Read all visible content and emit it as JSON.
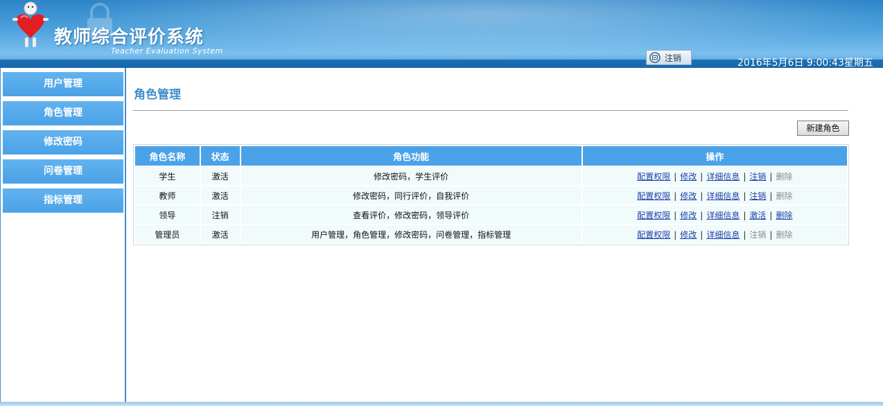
{
  "header": {
    "title_cn": "教师综合评价系统",
    "title_en": "Teacher Evaluation System",
    "logout_label": "注销",
    "datetime": "2016年5月6日 9:00:43星期五"
  },
  "sidebar": {
    "items": [
      {
        "label": "用户管理"
      },
      {
        "label": "角色管理"
      },
      {
        "label": "修改密码"
      },
      {
        "label": "问卷管理"
      },
      {
        "label": "指标管理"
      }
    ]
  },
  "main": {
    "page_title": "角色管理",
    "new_role_label": "新建角色",
    "table": {
      "columns": [
        "角色名称",
        "状态",
        "角色功能",
        "操作"
      ],
      "rows": [
        {
          "name": "学生",
          "status": "激活",
          "functions": "修改密码，学生评价",
          "ops": [
            {
              "label": "配置权限",
              "enabled": true
            },
            {
              "label": "修改",
              "enabled": true
            },
            {
              "label": "详细信息",
              "enabled": true
            },
            {
              "label": "注销",
              "enabled": true
            },
            {
              "label": "删除",
              "enabled": false
            }
          ]
        },
        {
          "name": "教师",
          "status": "激活",
          "functions": "修改密码，同行评价，自我评价",
          "ops": [
            {
              "label": "配置权限",
              "enabled": true
            },
            {
              "label": "修改",
              "enabled": true
            },
            {
              "label": "详细信息",
              "enabled": true
            },
            {
              "label": "注销",
              "enabled": true
            },
            {
              "label": "删除",
              "enabled": false
            }
          ]
        },
        {
          "name": "领导",
          "status": "注销",
          "functions": "查看评价，修改密码，领导评价",
          "ops": [
            {
              "label": "配置权限",
              "enabled": true
            },
            {
              "label": "修改",
              "enabled": true
            },
            {
              "label": "详细信息",
              "enabled": true
            },
            {
              "label": "激活",
              "enabled": true
            },
            {
              "label": "删除",
              "enabled": true
            }
          ]
        },
        {
          "name": "管理员",
          "status": "激活",
          "functions": "用户管理，角色管理，修改密码，问卷管理，指标管理",
          "ops": [
            {
              "label": "配置权限",
              "enabled": true
            },
            {
              "label": "修改",
              "enabled": true
            },
            {
              "label": "详细信息",
              "enabled": true
            },
            {
              "label": "注销",
              "enabled": false
            },
            {
              "label": "删除",
              "enabled": false
            }
          ]
        }
      ]
    }
  },
  "colors": {
    "accent": "#4aa2e8",
    "row_bg": "#f1fbfb",
    "link": "#1f3fa8",
    "disabled": "#8a8a8a"
  }
}
